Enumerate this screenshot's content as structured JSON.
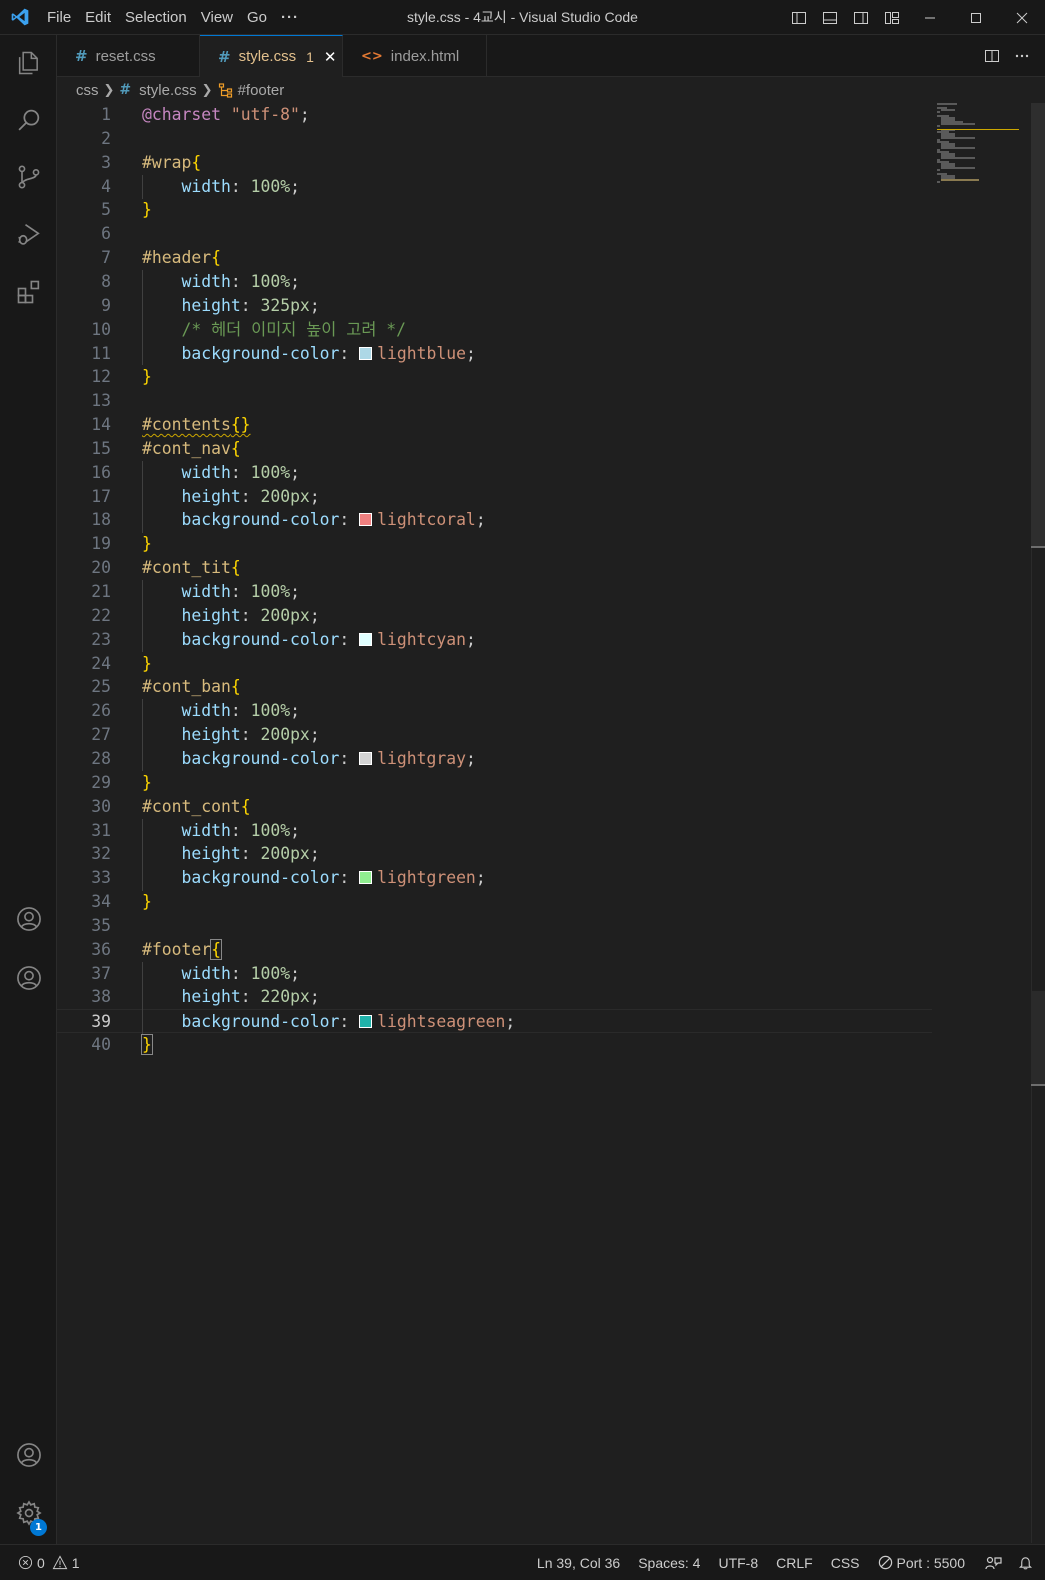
{
  "window": {
    "title": "style.css - 4교시 - Visual Studio Code",
    "menu": [
      "File",
      "Edit",
      "Selection",
      "View",
      "Go",
      "···"
    ]
  },
  "tabs": [
    {
      "label": "reset.css",
      "icon": "#",
      "icon_color": "#519aba"
    },
    {
      "label": "style.css",
      "icon": "#",
      "icon_color": "#519aba",
      "problems": "1",
      "active": true
    },
    {
      "label": "index.html",
      "icon": "<>",
      "icon_color": "#e37933"
    }
  ],
  "breadcrumb": {
    "folder": "css",
    "file": "style.css",
    "symbol": "#footer"
  },
  "editor": {
    "current_line": 39,
    "lines": [
      {
        "n": "1"
      },
      {
        "n": "2"
      },
      {
        "n": "3"
      },
      {
        "n": "4"
      },
      {
        "n": "5"
      },
      {
        "n": "6"
      },
      {
        "n": "7"
      },
      {
        "n": "8"
      },
      {
        "n": "9"
      },
      {
        "n": "10"
      },
      {
        "n": "11"
      },
      {
        "n": "12"
      },
      {
        "n": "13"
      },
      {
        "n": "14"
      },
      {
        "n": "15"
      },
      {
        "n": "16"
      },
      {
        "n": "17"
      },
      {
        "n": "18"
      },
      {
        "n": "19"
      },
      {
        "n": "20"
      },
      {
        "n": "21"
      },
      {
        "n": "22"
      },
      {
        "n": "23"
      },
      {
        "n": "24"
      },
      {
        "n": "25"
      },
      {
        "n": "26"
      },
      {
        "n": "27"
      },
      {
        "n": "28"
      },
      {
        "n": "29"
      },
      {
        "n": "30"
      },
      {
        "n": "31"
      },
      {
        "n": "32"
      },
      {
        "n": "33"
      },
      {
        "n": "34"
      },
      {
        "n": "35"
      },
      {
        "n": "36"
      },
      {
        "n": "37"
      },
      {
        "n": "38"
      },
      {
        "n": "39"
      },
      {
        "n": "40"
      }
    ],
    "code": {
      "charset_kw": "@charset",
      "charset_val": "\"utf-8\"",
      "wrap_sel": "#wrap",
      "header_sel": "#header",
      "header_comment": "/* 헤더 이미지 높이 고려 */",
      "contents_sel": "#contents",
      "cont_nav_sel": "#cont_nav",
      "cont_tit_sel": "#cont_tit",
      "cont_ban_sel": "#cont_ban",
      "cont_cont_sel": "#cont_cont",
      "footer_sel": "#footer",
      "prop_width": "width",
      "prop_height": "height",
      "prop_bg": "background-color",
      "val_100": "100",
      "val_325": "325",
      "val_200": "200",
      "val_220": "220",
      "unit_pct": "%",
      "unit_px": "px",
      "colors": {
        "lightblue": {
          "name": "lightblue",
          "hex": "#add8e6"
        },
        "lightcoral": {
          "name": "lightcoral",
          "hex": "#f08080"
        },
        "lightcyan": {
          "name": "lightcyan",
          "hex": "#e0ffff"
        },
        "lightgray": {
          "name": "lightgray",
          "hex": "#d3d3d3"
        },
        "lightgreen": {
          "name": "lightgreen",
          "hex": "#90ee90"
        },
        "lightseagreen": {
          "name": "lightseagreen",
          "hex": "#20b2aa"
        }
      }
    }
  },
  "status": {
    "errors": "0",
    "warnings": "1",
    "position": "Ln 39, Col 36",
    "spaces": "Spaces: 4",
    "encoding": "UTF-8",
    "eol": "CRLF",
    "language": "CSS",
    "port": "Port : 5500"
  },
  "activity": {
    "settings_badge": "1"
  },
  "theme": {
    "accent": "#0078d4",
    "selector": "#d7ba7d",
    "property": "#9cdcfe",
    "number": "#b5cea8",
    "string": "#ce9178",
    "comment": "#6a9955",
    "bracket": "#ffd700"
  }
}
